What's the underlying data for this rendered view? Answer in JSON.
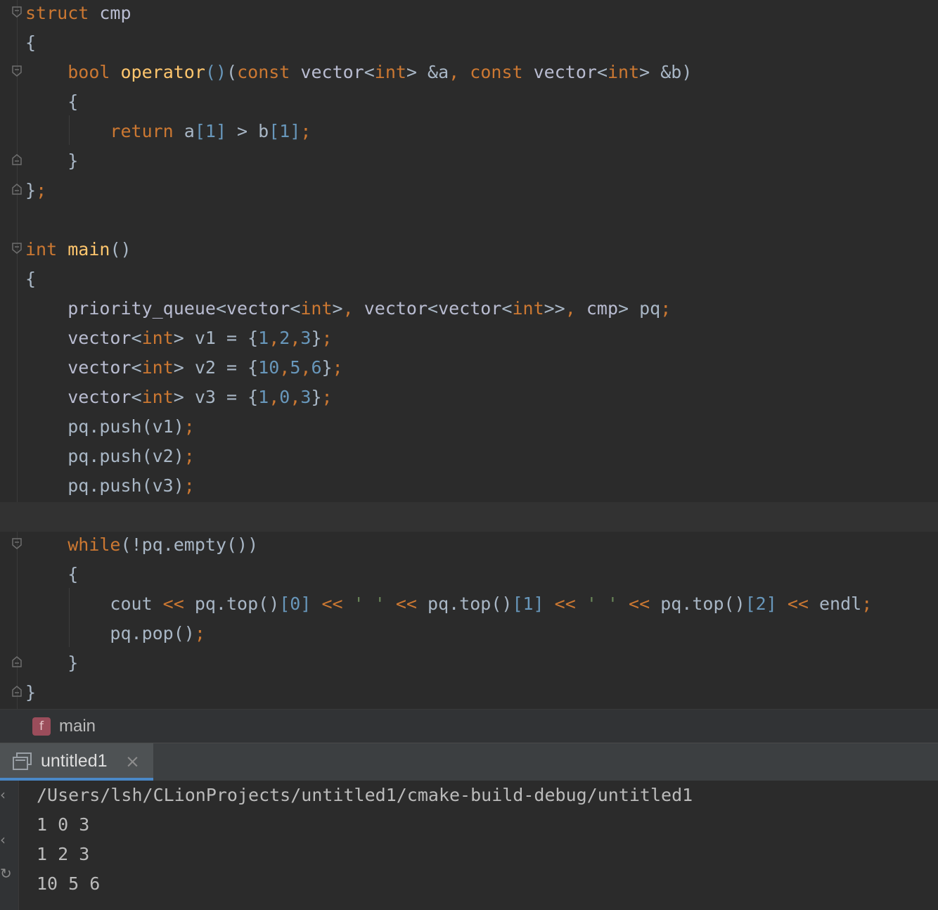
{
  "editor": {
    "lines": [
      {
        "segments": [
          {
            "c": "k",
            "t": "struct"
          },
          {
            "c": "p",
            "t": " "
          },
          {
            "c": "t",
            "t": "cmp"
          }
        ]
      },
      {
        "segments": [
          {
            "c": "p",
            "t": "{"
          }
        ]
      },
      {
        "segments": [
          {
            "c": "p",
            "t": "    "
          },
          {
            "c": "k",
            "t": "bool"
          },
          {
            "c": "p",
            "t": " "
          },
          {
            "c": "fn",
            "t": "operator"
          },
          {
            "c": "n",
            "t": "()"
          },
          {
            "c": "p",
            "t": "("
          },
          {
            "c": "k",
            "t": "const"
          },
          {
            "c": "p",
            "t": " "
          },
          {
            "c": "t",
            "t": "vector"
          },
          {
            "c": "p",
            "t": "<"
          },
          {
            "c": "k",
            "t": "int"
          },
          {
            "c": "p",
            "t": "> &a"
          },
          {
            "c": "k",
            "t": ","
          },
          {
            "c": "p",
            "t": " "
          },
          {
            "c": "k",
            "t": "const"
          },
          {
            "c": "p",
            "t": " "
          },
          {
            "c": "t",
            "t": "vector"
          },
          {
            "c": "p",
            "t": "<"
          },
          {
            "c": "k",
            "t": "int"
          },
          {
            "c": "p",
            "t": "> &b)"
          }
        ]
      },
      {
        "segments": [
          {
            "c": "p",
            "t": "    {"
          }
        ]
      },
      {
        "segments": [
          {
            "c": "p",
            "t": "        "
          },
          {
            "c": "k",
            "t": "return"
          },
          {
            "c": "p",
            "t": " a"
          },
          {
            "c": "n",
            "t": "[1]"
          },
          {
            "c": "p",
            "t": " > b"
          },
          {
            "c": "n",
            "t": "[1]"
          },
          {
            "c": "k",
            "t": ";"
          }
        ]
      },
      {
        "segments": [
          {
            "c": "p",
            "t": "    }"
          }
        ]
      },
      {
        "segments": [
          {
            "c": "p",
            "t": "}"
          },
          {
            "c": "k",
            "t": ";"
          }
        ]
      },
      {
        "segments": []
      },
      {
        "segments": [
          {
            "c": "k",
            "t": "int"
          },
          {
            "c": "p",
            "t": " "
          },
          {
            "c": "fn",
            "t": "main"
          },
          {
            "c": "p",
            "t": "()"
          }
        ]
      },
      {
        "segments": [
          {
            "c": "p",
            "t": "{"
          }
        ]
      },
      {
        "segments": [
          {
            "c": "p",
            "t": "    "
          },
          {
            "c": "t",
            "t": "priority_queue"
          },
          {
            "c": "p",
            "t": "<"
          },
          {
            "c": "t",
            "t": "vector"
          },
          {
            "c": "p",
            "t": "<"
          },
          {
            "c": "k",
            "t": "int"
          },
          {
            "c": "p",
            "t": ">"
          },
          {
            "c": "k",
            "t": ","
          },
          {
            "c": "p",
            "t": " "
          },
          {
            "c": "t",
            "t": "vector"
          },
          {
            "c": "p",
            "t": "<"
          },
          {
            "c": "t",
            "t": "vector"
          },
          {
            "c": "p",
            "t": "<"
          },
          {
            "c": "k",
            "t": "int"
          },
          {
            "c": "p",
            "t": ">>"
          },
          {
            "c": "k",
            "t": ","
          },
          {
            "c": "p",
            "t": " "
          },
          {
            "c": "t",
            "t": "cmp"
          },
          {
            "c": "p",
            "t": "> pq"
          },
          {
            "c": "k",
            "t": ";"
          }
        ]
      },
      {
        "segments": [
          {
            "c": "p",
            "t": "    "
          },
          {
            "c": "t",
            "t": "vector"
          },
          {
            "c": "p",
            "t": "<"
          },
          {
            "c": "k",
            "t": "int"
          },
          {
            "c": "p",
            "t": "> v1 = {"
          },
          {
            "c": "n",
            "t": "1"
          },
          {
            "c": "k",
            "t": ","
          },
          {
            "c": "n",
            "t": "2"
          },
          {
            "c": "k",
            "t": ","
          },
          {
            "c": "n",
            "t": "3"
          },
          {
            "c": "p",
            "t": "}"
          },
          {
            "c": "k",
            "t": ";"
          }
        ]
      },
      {
        "segments": [
          {
            "c": "p",
            "t": "    "
          },
          {
            "c": "t",
            "t": "vector"
          },
          {
            "c": "p",
            "t": "<"
          },
          {
            "c": "k",
            "t": "int"
          },
          {
            "c": "p",
            "t": "> v2 = {"
          },
          {
            "c": "n",
            "t": "10"
          },
          {
            "c": "k",
            "t": ","
          },
          {
            "c": "n",
            "t": "5"
          },
          {
            "c": "k",
            "t": ","
          },
          {
            "c": "n",
            "t": "6"
          },
          {
            "c": "p",
            "t": "}"
          },
          {
            "c": "k",
            "t": ";"
          }
        ]
      },
      {
        "segments": [
          {
            "c": "p",
            "t": "    "
          },
          {
            "c": "t",
            "t": "vector"
          },
          {
            "c": "p",
            "t": "<"
          },
          {
            "c": "k",
            "t": "int"
          },
          {
            "c": "p",
            "t": "> v3 = {"
          },
          {
            "c": "n",
            "t": "1"
          },
          {
            "c": "k",
            "t": ","
          },
          {
            "c": "n",
            "t": "0"
          },
          {
            "c": "k",
            "t": ","
          },
          {
            "c": "n",
            "t": "3"
          },
          {
            "c": "p",
            "t": "}"
          },
          {
            "c": "k",
            "t": ";"
          }
        ]
      },
      {
        "segments": [
          {
            "c": "p",
            "t": "    pq.push(v1)"
          },
          {
            "c": "k",
            "t": ";"
          }
        ]
      },
      {
        "segments": [
          {
            "c": "p",
            "t": "    pq.push(v2)"
          },
          {
            "c": "k",
            "t": ";"
          }
        ]
      },
      {
        "segments": [
          {
            "c": "p",
            "t": "    pq.push(v3)"
          },
          {
            "c": "k",
            "t": ";"
          }
        ]
      },
      {
        "segments": []
      },
      {
        "segments": [
          {
            "c": "p",
            "t": "    "
          },
          {
            "c": "k",
            "t": "while"
          },
          {
            "c": "p",
            "t": "(!pq.empty())"
          }
        ]
      },
      {
        "segments": [
          {
            "c": "p",
            "t": "    {"
          }
        ]
      },
      {
        "segments": [
          {
            "c": "p",
            "t": "        cout "
          },
          {
            "c": "k",
            "t": "<<"
          },
          {
            "c": "p",
            "t": " pq.top()"
          },
          {
            "c": "n",
            "t": "[0]"
          },
          {
            "c": "p",
            "t": " "
          },
          {
            "c": "k",
            "t": "<<"
          },
          {
            "c": "p",
            "t": " "
          },
          {
            "c": "s",
            "t": "' '"
          },
          {
            "c": "p",
            "t": " "
          },
          {
            "c": "k",
            "t": "<<"
          },
          {
            "c": "p",
            "t": " pq.top()"
          },
          {
            "c": "n",
            "t": "[1]"
          },
          {
            "c": "p",
            "t": " "
          },
          {
            "c": "k",
            "t": "<<"
          },
          {
            "c": "p",
            "t": " "
          },
          {
            "c": "s",
            "t": "' '"
          },
          {
            "c": "p",
            "t": " "
          },
          {
            "c": "k",
            "t": "<<"
          },
          {
            "c": "p",
            "t": " pq.top()"
          },
          {
            "c": "n",
            "t": "[2]"
          },
          {
            "c": "p",
            "t": " "
          },
          {
            "c": "k",
            "t": "<<"
          },
          {
            "c": "p",
            "t": " endl"
          },
          {
            "c": "k",
            "t": ";"
          }
        ]
      },
      {
        "segments": [
          {
            "c": "p",
            "t": "        pq.pop()"
          },
          {
            "c": "k",
            "t": ";"
          }
        ]
      },
      {
        "segments": [
          {
            "c": "p",
            "t": "    }"
          }
        ]
      },
      {
        "segments": [
          {
            "c": "p",
            "t": "}"
          }
        ]
      }
    ]
  },
  "breadcrumb": {
    "badge": "f",
    "label": "main"
  },
  "run_panel": {
    "tab_label": "untitled1",
    "close": "×"
  },
  "console": {
    "lines": [
      "/Users/lsh/CLionProjects/untitled1/cmake-build-debug/untitled1",
      "1 0 3",
      "1 2 3",
      "10 5 6"
    ]
  },
  "colors": {
    "keyword": "#cc7832",
    "function": "#ffc66d",
    "type": "#b9bcd1",
    "number": "#6897bb",
    "plain": "#a9b7c6",
    "accent": "#4a88c7"
  }
}
